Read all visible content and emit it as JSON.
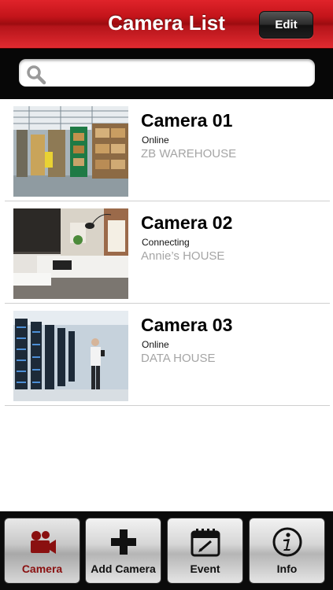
{
  "header": {
    "title": "Camera List",
    "edit_label": "Edit"
  },
  "search": {
    "placeholder": "",
    "value": "",
    "icon": "search-icon"
  },
  "cameras": [
    {
      "name": "Camera 01",
      "status": "Online",
      "location": "ZB WAREHOUSE",
      "thumbnail": "warehouse"
    },
    {
      "name": "Camera 02",
      "status": "Connecting",
      "location": "Annie’s HOUSE",
      "thumbnail": "living-room"
    },
    {
      "name": "Camera 03",
      "status": "Online",
      "location": "DATA HOUSE",
      "thumbnail": "server-room"
    }
  ],
  "tabbar": {
    "tabs": [
      {
        "label": "Camera",
        "icon": "video-camera-icon",
        "active": true
      },
      {
        "label": "Add Camera",
        "icon": "plus-icon",
        "active": false
      },
      {
        "label": "Event",
        "icon": "calendar-icon",
        "active": false
      },
      {
        "label": "Info",
        "icon": "info-icon",
        "active": false
      }
    ]
  },
  "colors": {
    "header_red": "#c3141a",
    "active_tab_text": "#8a1010",
    "location_gray": "#a5a5a5"
  }
}
